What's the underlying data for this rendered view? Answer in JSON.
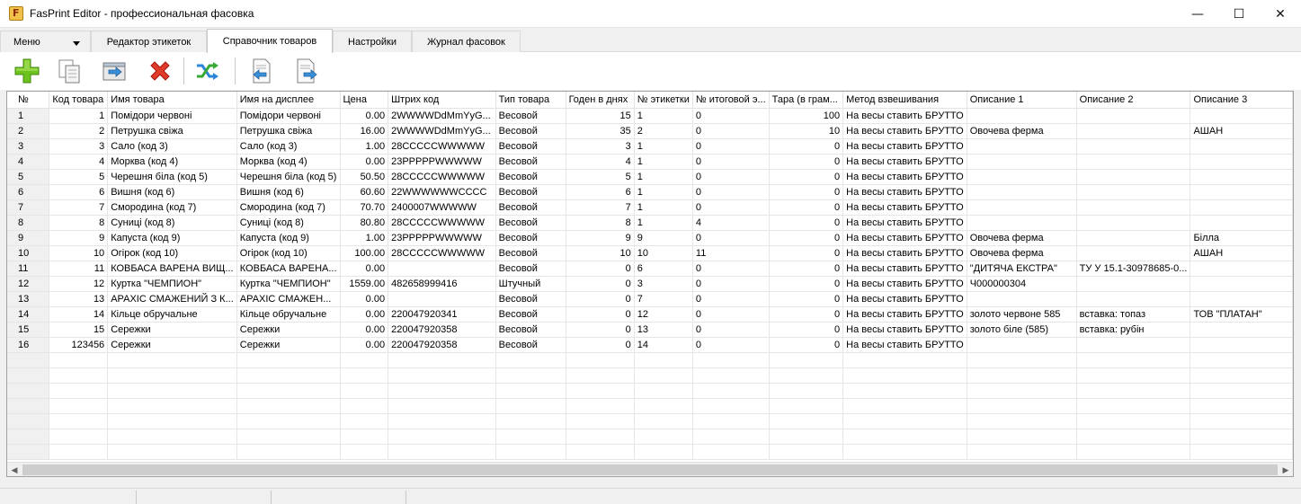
{
  "window": {
    "title": "FasPrint Editor - профессиональная фасовка"
  },
  "tabs": [
    {
      "label": "Меню"
    },
    {
      "label": "Редактор этикеток"
    },
    {
      "label": "Справочник товаров",
      "active": true
    },
    {
      "label": "Настройки"
    },
    {
      "label": "Журнал фасовок"
    }
  ],
  "toolbar": {
    "buttons": [
      "add-icon",
      "copy-icon",
      "import-icon",
      "delete-icon",
      "shuffle-icon",
      "document-import-icon",
      "document-export-icon"
    ]
  },
  "grid": {
    "columns": [
      "№",
      "Код товара",
      "Имя товара",
      "Имя на дисплее",
      "Цена",
      "Штрих код",
      "Тип товара",
      "Годен в днях",
      "№ этикетки",
      "№ итоговой э...",
      "Тара (в грам...",
      "Метод взвешивания",
      "Описание 1",
      "Описание 2",
      "Описание 3"
    ],
    "rows": [
      [
        "1",
        "1",
        "Помідори червоні",
        "Помідори червоні",
        "0.00",
        "2WWWWDdMmYyG...",
        "Весовой",
        "15",
        "1",
        "0",
        "100",
        "На весы ставить БРУТТО",
        "",
        "",
        ""
      ],
      [
        "2",
        "2",
        "Петрушка свіжа",
        "Петрушка свіжа",
        "16.00",
        "2WWWWDdMmYyG...",
        "Весовой",
        "35",
        "2",
        "0",
        "10",
        "На весы ставить БРУТТО",
        "Овочева ферма",
        "",
        "АШАН"
      ],
      [
        "3",
        "3",
        "Сало (код 3)",
        "Сало (код 3)",
        "1.00",
        "28CCCCCWWWWW",
        "Весовой",
        "3",
        "1",
        "0",
        "0",
        "На весы ставить БРУТТО",
        "",
        "",
        ""
      ],
      [
        "4",
        "4",
        "Морква (код 4)",
        "Морква (код 4)",
        "0.00",
        "23PPPPPWWWWW",
        "Весовой",
        "4",
        "1",
        "0",
        "0",
        "На весы ставить БРУТТО",
        "",
        "",
        ""
      ],
      [
        "5",
        "5",
        "Черешня біла (код 5)",
        "Черешня біла (код 5)",
        "50.50",
        "28CCCCCWWWWW",
        "Весовой",
        "5",
        "1",
        "0",
        "0",
        "На весы ставить БРУТТО",
        "",
        "",
        ""
      ],
      [
        "6",
        "6",
        "Вишня (код 6)",
        "Вишня (код 6)",
        "60.60",
        "22WWWWWWCCCC",
        "Весовой",
        "6",
        "1",
        "0",
        "0",
        "На весы ставить БРУТТО",
        "",
        "",
        ""
      ],
      [
        "7",
        "7",
        "Смородина (код 7)",
        "Смородина (код 7)",
        "70.70",
        "2400007WWWWW",
        "Весовой",
        "7",
        "1",
        "0",
        "0",
        "На весы ставить БРУТТО",
        "",
        "",
        ""
      ],
      [
        "8",
        "8",
        "Суниці (код 8)",
        "Суниці (код 8)",
        "80.80",
        "28CCCCCWWWWW",
        "Весовой",
        "8",
        "1",
        "4",
        "0",
        "На весы ставить БРУТТО",
        "",
        "",
        ""
      ],
      [
        "9",
        "9",
        "Капуста (код 9)",
        "Капуста (код 9)",
        "1.00",
        "23PPPPPWWWWW",
        "Весовой",
        "9",
        "9",
        "0",
        "0",
        "На весы ставить БРУТТО",
        "Овочева ферма",
        "",
        "Білла"
      ],
      [
        "10",
        "10",
        "Огірок (код 10)",
        "Огірок (код 10)",
        "100.00",
        "28CCCCCWWWWW",
        "Весовой",
        "10",
        "10",
        "11",
        "0",
        "На весы ставить БРУТТО",
        "Овочева ферма",
        "",
        "АШАН"
      ],
      [
        "11",
        "11",
        "КОВБАСА ВАРЕНА ВИЩ...",
        "КОВБАСА ВАРЕНА...",
        "0.00",
        "",
        "Весовой",
        "0",
        "6",
        "0",
        "0",
        "На весы ставить БРУТТО",
        "\"ДИТЯЧА ЕКСТРА\"",
        "ТУ У 15.1-30978685-0...",
        ""
      ],
      [
        "12",
        "12",
        "Куртка \"ЧЕМПИОН\"",
        "Куртка \"ЧЕМПИОН\"",
        "1559.00",
        "482658999416",
        "Штучный",
        "0",
        "3",
        "0",
        "0",
        "На весы ставить БРУТТО",
        "Ч000000304",
        "",
        ""
      ],
      [
        "13",
        "13",
        "АРАХІС СМАЖЕНИЙ З К...",
        "АРАХІС СМАЖЕН...",
        "0.00",
        "",
        "Весовой",
        "0",
        "7",
        "0",
        "0",
        "На весы ставить БРУТТО",
        "",
        "",
        ""
      ],
      [
        "14",
        "14",
        "Кільце обручальне",
        "Кільце обручальне",
        "0.00",
        "220047920341",
        "Весовой",
        "0",
        "12",
        "0",
        "0",
        "На весы ставить БРУТТО",
        "золото червоне 585",
        "вставка: топаз",
        "ТОВ \"ПЛАТАН\""
      ],
      [
        "15",
        "15",
        "Сережки",
        "Сережки",
        "0.00",
        "220047920358",
        "Весовой",
        "0",
        "13",
        "0",
        "0",
        "На весы ставить БРУТТО",
        "золото біле (585)",
        "вставка: рубін",
        ""
      ],
      [
        "16",
        "123456",
        "Сережки",
        "Сережки",
        "0.00",
        "220047920358",
        "Весовой",
        "0",
        "14",
        "0",
        "0",
        "На весы ставить БРУТТО",
        "",
        "",
        ""
      ]
    ],
    "numeric_columns": [
      1,
      4,
      7,
      10
    ],
    "empty_rows": 7
  },
  "window_controls": {
    "minimize": "—",
    "maximize": "☐",
    "close": "✕"
  }
}
